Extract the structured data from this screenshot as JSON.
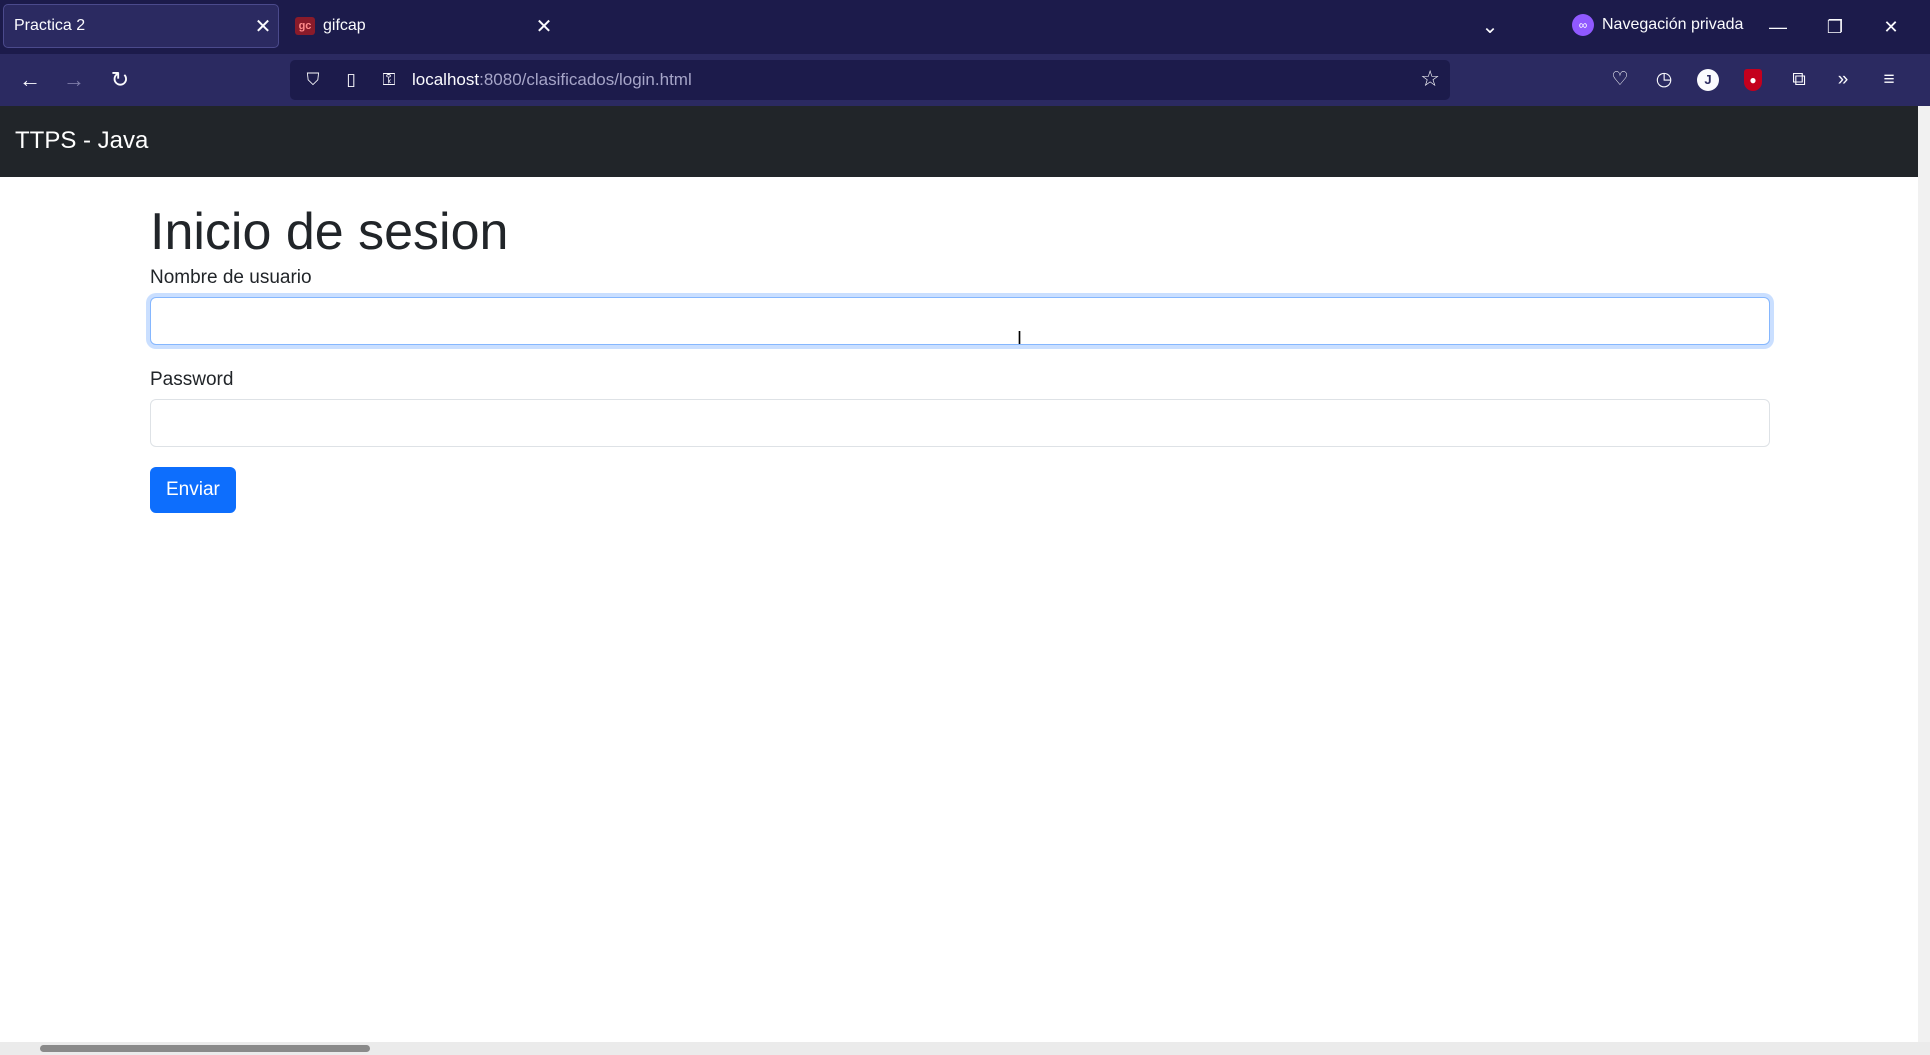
{
  "browser": {
    "tabs": [
      {
        "title": "Practica 2",
        "active": true
      },
      {
        "title": "gifcap",
        "active": false,
        "favicon": "gc"
      }
    ],
    "private_label": "Navegación privada",
    "url": {
      "host": "localhost",
      "path": ":8080/clasificados/login.html"
    }
  },
  "app": {
    "brand": "TTPS - Java"
  },
  "form": {
    "heading": "Inicio de sesion",
    "username_label": "Nombre de usuario",
    "username_value": "",
    "password_label": "Password",
    "password_value": "",
    "submit_label": "Enviar"
  },
  "colors": {
    "tabbar": "#1c1b4b",
    "toolbar": "#2b2a61",
    "appnav": "#212529",
    "primary": "#0d6efd"
  }
}
